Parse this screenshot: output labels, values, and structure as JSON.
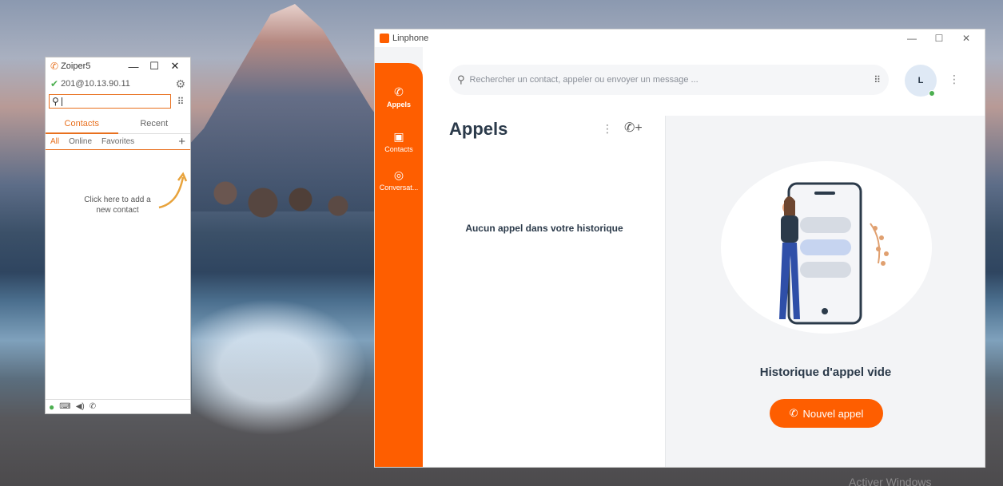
{
  "desktop": {
    "watermark": "Activer Windows"
  },
  "zoiper": {
    "title": "Zoiper5",
    "account": "201@10.13.90.11",
    "search_placeholder": "",
    "tabs": [
      "Contacts",
      "Recent"
    ],
    "subtabs": [
      "All",
      "Online",
      "Favorites"
    ],
    "add_contact_hint": "Click here to add a new contact",
    "colors": {
      "accent": "#e8701e",
      "status_ok": "#4caf50"
    }
  },
  "linphone": {
    "title": "Linphone",
    "search_placeholder": "Rechercher un contact, appeler ou envoyer un message ...",
    "avatar_initial": "L",
    "nav": [
      {
        "label": "Appels",
        "icon": "phone-icon"
      },
      {
        "label": "Contacts",
        "icon": "contacts-icon"
      },
      {
        "label": "Conversat...",
        "icon": "chat-icon"
      }
    ],
    "calls_title": "Appels",
    "empty_history": "Aucun appel dans votre historique",
    "main_title": "Historique d'appel vide",
    "new_call_button": "Nouvel appel",
    "colors": {
      "accent": "#fe5e00",
      "text": "#2b3a4a"
    }
  }
}
